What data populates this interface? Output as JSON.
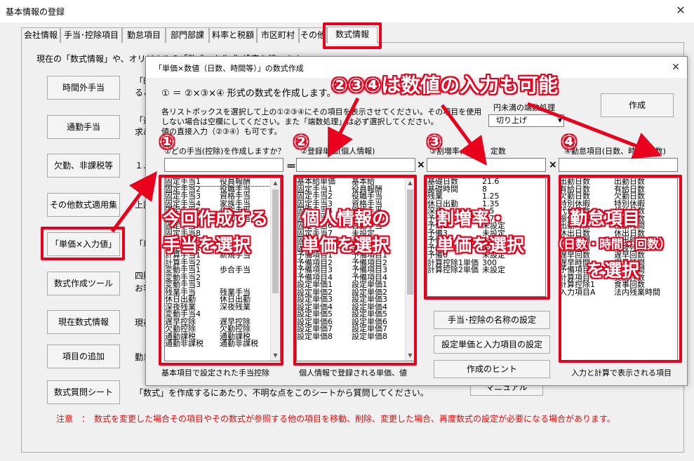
{
  "window": {
    "title": "基本情報の登録",
    "close": "✕"
  },
  "tabs": [
    "会社情報",
    "手当･控除項目",
    "勤怠項目",
    "部門部課",
    "料率と税額",
    "市区町村",
    "その他",
    "数式情報"
  ],
  "intro_text": "現在の「数式情報」や、オリジナルの「数式」を作成･設定を行います",
  "side_buttons": [
    {
      "label": "時間外手当",
      "desc": "「時",
      "desc2": "るこ"
    },
    {
      "label": "通勤手当",
      "desc": "「通",
      "desc2": "求め"
    },
    {
      "label": "欠勤、非課税等",
      "desc": "１."
    },
    {
      "label": "その他数式適用集",
      "desc": "上記"
    },
    {
      "label": "「単価×入力値」",
      "desc": "「単"
    },
    {
      "label": "数式作成ツール",
      "desc": "四則",
      "desc2": "お客"
    },
    {
      "label": "現在数式情報",
      "desc": "現在"
    },
    {
      "label": "項目の追加",
      "desc": "勤怠"
    },
    {
      "label": "数式質問シート",
      "desc": "「数式」を作成するにあたり、不明な点をこのシートから質問してください。"
    }
  ],
  "manual_button": "マニュアル",
  "notice": "注意　：　数式を変更した場合その項目やその数式が参照する他の項目を移動、削除、変更した場合、再度数式の設定が必要になる場合があります。",
  "dialog": {
    "title": "「単価×数値（日数、時間等）」の数式作成",
    "close": "✕",
    "formula": "① ＝ ②×③×④ 形式の数式を作成します。",
    "instructions": [
      "各リストボックスを選択して上の①②③④にその項目を表示させてください。その項目を使用",
      "しない場合は空欄にしてください。また「端数処理」は必ず選択してください。",
      "値の直接入力（②③④）も可です。"
    ],
    "rounding_label": "円未満の端数処理",
    "rounding_value": "切り上げ",
    "create_button": "作成",
    "field_labels": [
      "①どの手当(控除)を作成しますか？",
      "②登録単価(個人情報)",
      "③割増率、単価、定数",
      "④勤怠項目(日数、時間･回数)"
    ],
    "ops": [
      "＝",
      "×",
      "×"
    ],
    "list1": [
      [
        "固定手当1",
        "役員報酬"
      ],
      [
        "固定手当2",
        "役職手当"
      ],
      [
        "固定手当3",
        "資格手当"
      ],
      [
        "固定手当4",
        "家族手当"
      ],
      [
        "固定手当5",
        "住宅手当"
      ],
      [
        "固定手当6",
        "皆勤手当"
      ],
      [
        "固定手当7",
        ""
      ],
      [
        "固定手当8",
        ""
      ],
      [
        "固定手当9",
        ""
      ],
      [
        "固定手当10",
        ""
      ],
      [
        "計算手当1",
        "新規手当"
      ],
      [
        "計算手当2",
        ""
      ],
      [
        "変動手当1",
        "歩合手当"
      ],
      [
        "変動手当2",
        ""
      ],
      [
        "変動手当3",
        ""
      ],
      [
        "残業手当",
        "残業手当"
      ],
      [
        "休日出勤",
        "休日出勤"
      ],
      [
        "深夜残業",
        "深夜残業"
      ],
      [
        "変動手当4",
        ""
      ],
      [
        "遅早控除",
        "遅早控除"
      ],
      [
        "欠勤控除",
        "欠勤控除"
      ],
      [
        "通勤課税",
        "通勤課税"
      ],
      [
        "通勤非課税",
        "通勤非課税"
      ]
    ],
    "list2": [
      [
        "基本給単価",
        "基本給"
      ],
      [
        "固定手当1",
        "役員報酬"
      ],
      [
        "固定手当2",
        "役職手当"
      ],
      [
        "固定手当3",
        "資格手当"
      ],
      [
        "固定手当4",
        "家族手当"
      ],
      [
        "固定手当5",
        "住宅手当"
      ],
      [
        "固定手当6",
        "皆勤手当"
      ],
      [
        "固定手当7",
        "未設定"
      ],
      [
        "固定手当8",
        "未設定"
      ],
      [
        "固定手当9",
        "未設定"
      ],
      [
        "予備項目1",
        "予備項目1"
      ],
      [
        "予備項目2",
        "予備項目2"
      ],
      [
        "予備項目3",
        "予備項目3"
      ],
      [
        "予備項目4",
        "予備項目4"
      ],
      [
        "設定単価1",
        "設定単価1"
      ],
      [
        "設定単価2",
        "設定単価2"
      ],
      [
        "設定単価3",
        "設定単価3"
      ],
      [
        "設定単価4",
        "設定単価4"
      ],
      [
        "設定単価5",
        "設定単価5"
      ],
      [
        "設定単価6",
        "設定単価6"
      ],
      [
        "設定単価7",
        "設定単価7"
      ],
      [
        "設定単価8",
        "設定単価8"
      ]
    ],
    "list3": [
      [
        "基礎日数",
        "21.6"
      ],
      [
        "基礎時間",
        "8"
      ],
      [
        "残業",
        "1.25"
      ],
      [
        "休日出勤",
        "1.35"
      ],
      [
        "深夜",
        "1.5"
      ],
      [
        "予備1",
        "1.71"
      ],
      [
        "予備2",
        "未設定"
      ],
      [
        "予備3",
        "未設定"
      ],
      [
        "予備4",
        "未設定"
      ],
      [
        "予備5",
        "未設定"
      ],
      [
        "予備6",
        "未設定"
      ],
      [
        "計算控除1単価",
        "300"
      ],
      [
        "計算控除2単価",
        "未設定"
      ]
    ],
    "list4": [
      [
        "出勤日数",
        "出勤日数"
      ],
      [
        "有給日数",
        "有給日数"
      ],
      [
        "欠勤日数",
        "欠勤日数"
      ],
      [
        "特別休暇",
        "特別休暇"
      ],
      [
        "代休日数",
        "代休日数"
      ],
      [
        "振休日数",
        "振休日数"
      ],
      [
        "出勤時間",
        "出勤時間"
      ],
      [
        "休出日数",
        "休出日数"
      ],
      [
        "休出時間",
        "休出時間"
      ],
      [
        "深夜残業",
        "深夜残業"
      ],
      [
        "遅早回数",
        "遅早回数"
      ],
      [
        "遅早時間",
        "遅早時間"
      ],
      [
        "予備項目",
        "遅早時間"
      ],
      [
        "計算項目",
        "契約件数"
      ],
      [
        "計算控除1",
        "食事回数"
      ],
      [
        "入力項目A",
        "法内残業時間"
      ]
    ],
    "buttons": [
      "手当･控除の名称の設定",
      "設定単価と入力項目の設定",
      "作成のヒント"
    ],
    "captions": [
      "基本項目で設定された手当控除",
      "個人情報で登録される単価、値",
      "入力と計算で表示される項目"
    ]
  },
  "annotations": {
    "headline": "②③④は数値の入力も可能",
    "circled": [
      "①",
      "②",
      "③",
      "④"
    ],
    "overlay1": [
      "今回作成する",
      "手当を選択"
    ],
    "overlay2": [
      "個人情報の",
      "単価を選択"
    ],
    "overlay3": [
      "割増率・",
      "単価を選択"
    ],
    "overlay4": [
      "勤怠項目",
      "（日数・時間・回数）",
      "を選択"
    ]
  },
  "colors": {
    "annotation_red": "#e8001c",
    "notice_red": "#ff0000"
  }
}
